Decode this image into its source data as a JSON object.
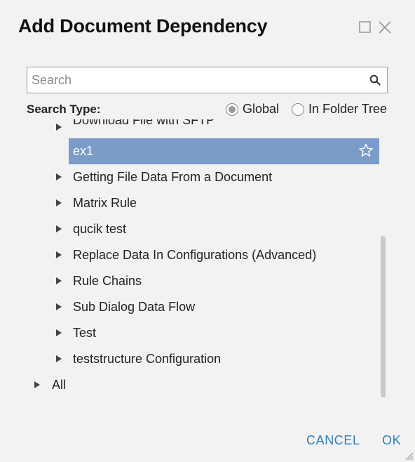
{
  "dialog": {
    "title": "Add Document Dependency",
    "maximize_icon": "maximize-icon",
    "close_icon": "close-icon"
  },
  "search": {
    "placeholder": "Search",
    "value": "",
    "icon": "search-icon"
  },
  "search_type": {
    "label": "Search Type:",
    "options": [
      {
        "label": "Global",
        "checked": true
      },
      {
        "label": "In Folder Tree",
        "checked": false
      }
    ]
  },
  "tree": {
    "partial_item": "Download File with SFTP",
    "selected_item": {
      "label": "ex1",
      "icon": "star-icon"
    },
    "items": [
      {
        "label": "Getting File Data From a Document"
      },
      {
        "label": "Matrix Rule"
      },
      {
        "label": "qucik test"
      },
      {
        "label": "Replace Data In Configurations (Advanced)"
      },
      {
        "label": "Rule Chains"
      },
      {
        "label": "Sub Dialog Data Flow"
      },
      {
        "label": "Test"
      },
      {
        "label": "teststructure Configuration"
      }
    ],
    "root_item": {
      "label": "All"
    }
  },
  "footer": {
    "cancel_label": "CANCEL",
    "ok_label": "OK"
  },
  "colors": {
    "selection": "#7b9cc9",
    "link": "#2f7fb8",
    "background": "#f2f2f2"
  }
}
